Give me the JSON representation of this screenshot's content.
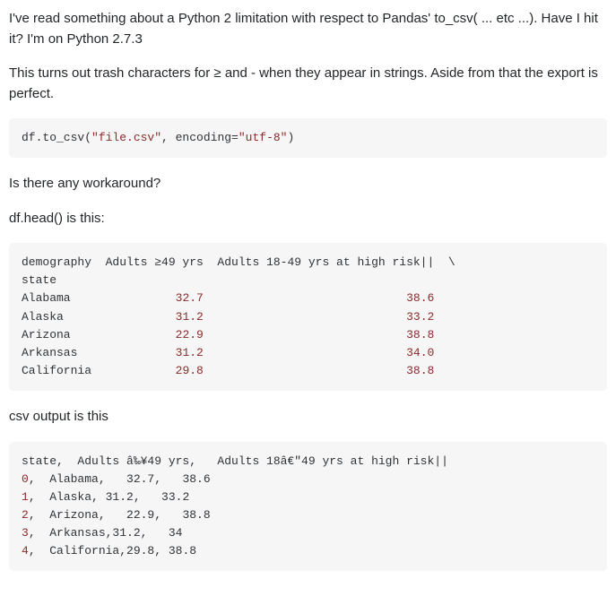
{
  "paragraphs": {
    "p1": "I've read something about a Python 2 limitation with respect to Pandas' to_csv( ... etc ...). Have I hit it? I'm on Python 2.7.3",
    "p2": "This turns out trash characters for ≥ and - when they appear in strings. Aside from that the export is perfect.",
    "p3": "Is there any workaround?",
    "p4": "df.head() is this:",
    "p5": "csv output is this"
  },
  "code": {
    "block1": {
      "pre": "df.to_csv(",
      "str1": "\"file.csv\"",
      "mid": ", encoding=",
      "str2": "\"utf-8\"",
      "post": ")"
    },
    "block2": {
      "line1": "demography  Adults ≥49 yrs  Adults 18-49 yrs at high risk||  \\",
      "line2": "state",
      "rows": [
        {
          "label": "Alabama               ",
          "v1": "32.7",
          "pad": "                             ",
          "v2": "38.6"
        },
        {
          "label": "Alaska                ",
          "v1": "31.2",
          "pad": "                             ",
          "v2": "33.2"
        },
        {
          "label": "Arizona               ",
          "v1": "22.9",
          "pad": "                             ",
          "v2": "38.8"
        },
        {
          "label": "Arkansas              ",
          "v1": "31.2",
          "pad": "                             ",
          "v2": "34.0"
        },
        {
          "label": "California            ",
          "v1": "29.8",
          "pad": "                             ",
          "v2": "38.8"
        }
      ]
    },
    "block3": {
      "header": "state,  Adults â‰¥49 yrs,   Adults 18â€\"49 yrs at high risk||",
      "rows": [
        {
          "idx": "0",
          "rest": ",  Alabama,   32.7,   38.6"
        },
        {
          "idx": "1",
          "rest": ",  Alaska, 31.2,   33.2"
        },
        {
          "idx": "2",
          "rest": ",  Arizona,   22.9,   38.8"
        },
        {
          "idx": "3",
          "rest": ",  Arkansas,31.2,   34"
        },
        {
          "idx": "4",
          "rest": ",  California,29.8, 38.8"
        }
      ]
    }
  }
}
